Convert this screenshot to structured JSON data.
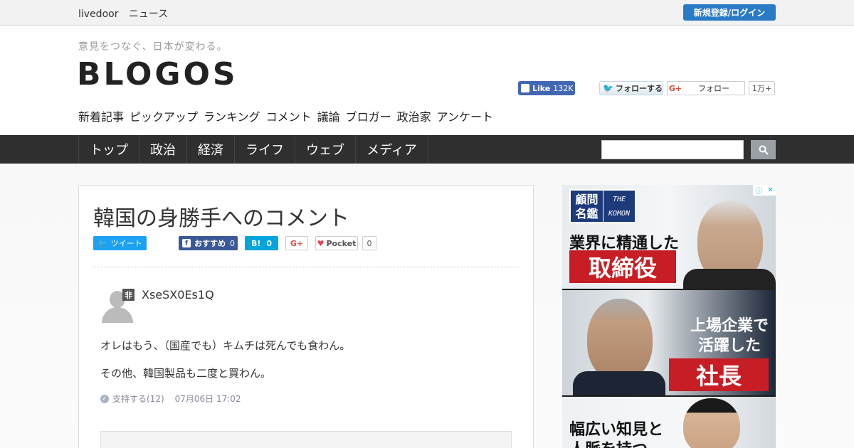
{
  "topbar": {
    "brand_1": "livedoor",
    "brand_2": "ニュース",
    "register_label": "新規登録/ログイン"
  },
  "header": {
    "tagline": "意見をつなぐ、日本が変わる。",
    "logo": "BLOGOS",
    "categories": [
      "新着記事",
      "ピックアップ",
      "ランキング",
      "コメント",
      "議論",
      "ブロガー",
      "政治家",
      "アンケート"
    ],
    "fb_like_label": "Like",
    "fb_like_count": "132K",
    "twitter_follow_label": "フォローする",
    "gplus_follow_label": "フォロー",
    "gplus_count": "1万+"
  },
  "nav": {
    "items": [
      "トップ",
      "政治",
      "経済",
      "ライフ",
      "ウェブ",
      "メディア"
    ]
  },
  "article": {
    "title": "韓国の身勝手へのコメント",
    "share": {
      "tweet_label": "ツイート",
      "fb_label": "おすすめ",
      "fb_count": "0",
      "hatena_label": "B!",
      "hatena_count": "0",
      "gplus_label": "G+",
      "pocket_label": "Pocket",
      "pocket_count": "0"
    }
  },
  "comment": {
    "badge": "非",
    "username": "XseSX0Es1Q",
    "lines": [
      "オレはもう、（国産でも）キムチは死んでも食わん。",
      "その他、韓国製品も二度と買わん。"
    ],
    "support_label": "支持する(12)",
    "timestamp": "07月06日 17:02"
  },
  "ad": {
    "logo_kanji_1": "顧問",
    "logo_kanji_2": "名鑑",
    "logo_latin_1": "THE",
    "logo_latin_2": "KOMON",
    "text_1": "業界に精通した",
    "red_1": "取締役",
    "text_2a": "上場企業で",
    "text_2b": "活躍した",
    "red_2": "社長",
    "text_3a": "幅広い知見と",
    "text_3b": "人脈を持つ"
  },
  "colors": {
    "accent": "#2a7bc6",
    "nav_bg": "#2f2f2f",
    "ad_red": "#c71d24"
  }
}
